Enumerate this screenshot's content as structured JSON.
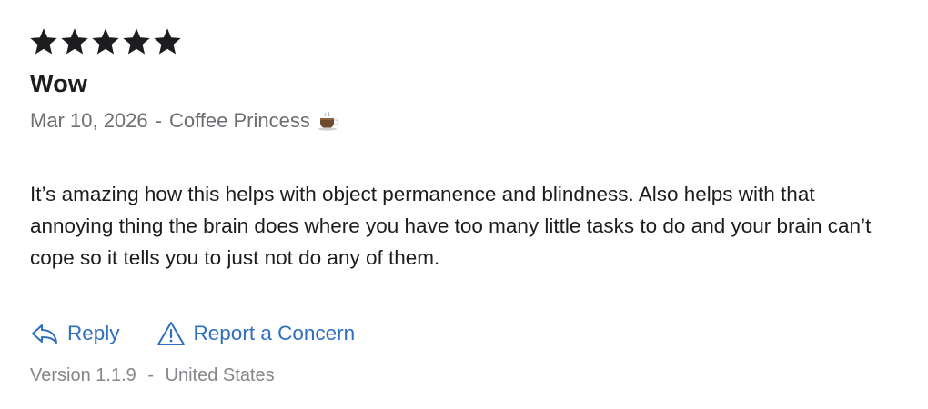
{
  "review": {
    "rating": 5,
    "max_rating": 5,
    "title": "Wow",
    "date": "Mar 10, 2026",
    "meta_separator": "-",
    "author": "Coffee Princess",
    "author_icon": "coffee-cup-icon",
    "body": "It’s amazing how this helps with object permanence and blindness. Also helps with that annoying thing the brain does where you have too many little tasks to do and your brain can’t cope so it tells you to just not do any of them."
  },
  "actions": {
    "reply_label": "Reply",
    "reply_icon": "reply-arrow-icon",
    "report_label": "Report a Concern",
    "report_icon": "warning-triangle-icon"
  },
  "footer": {
    "version": "Version 1.1.9",
    "separator": "-",
    "region": "United States"
  },
  "colors": {
    "star": "#1d1d1f",
    "link": "#2f6fbf",
    "text": "#1d1d1f",
    "secondary": "#6e6e73",
    "footer": "#86868b"
  }
}
